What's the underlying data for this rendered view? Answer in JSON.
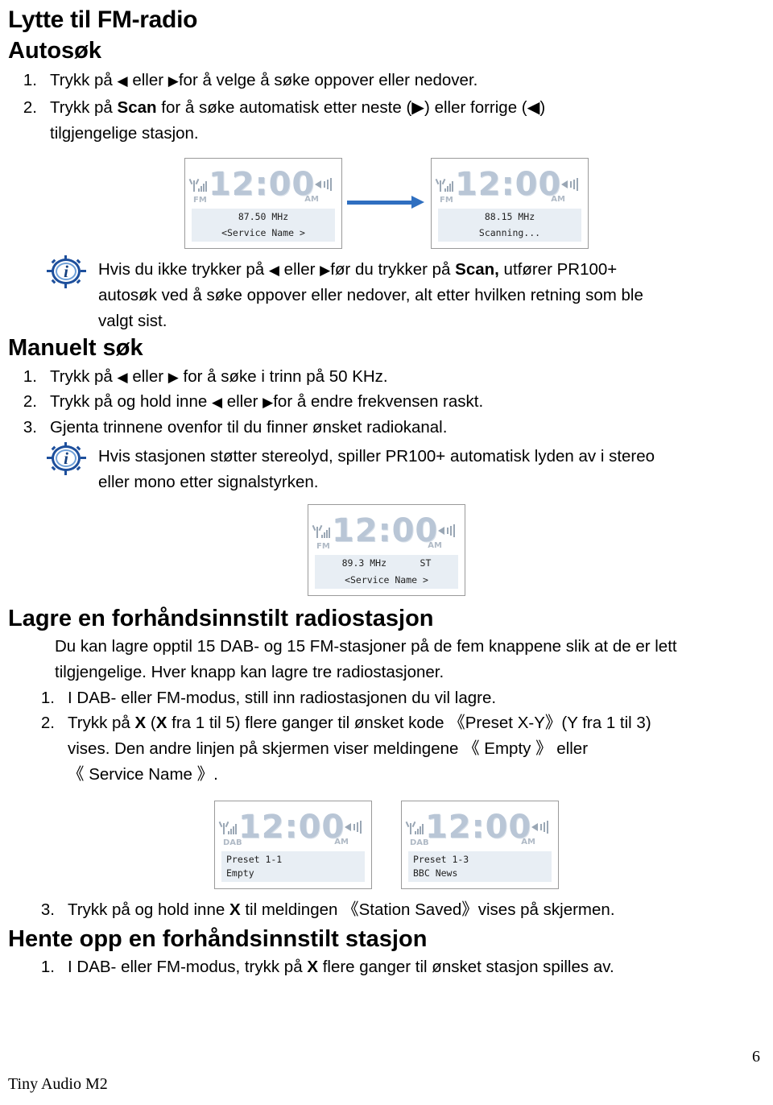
{
  "document": {
    "title": "Lytte til FM-radio",
    "footer_text": "Tiny Audio M2",
    "page_number": "6"
  },
  "sections": {
    "autosearch": {
      "heading": "Autosøk",
      "steps": [
        {
          "num": "1.",
          "text_before": "Trykk på ",
          "tri_left": "◀",
          "text_mid": " eller ",
          "tri_right": "▶",
          "text_after": "for å velge å søke oppover eller nedover."
        },
        {
          "num": "2.",
          "text": "Trykk på Scan for å søke automatisk etter neste (▶) eller forrige (◀) tilgjengelige stasjon.",
          "bold_word": "Scan"
        }
      ],
      "step2_line1_pre": "Trykk på ",
      "step2_scan": "Scan",
      "step2_line1_post": " for å søke automatisk etter neste (▶) eller forrige (◀)",
      "step2_line2": "tilgjengelige stasjon.",
      "note": {
        "icon": "info-icon",
        "line1_pre": "Hvis du ikke trykker på ",
        "tri_left": "◀",
        "line1_mid": " eller ",
        "tri_right": "▶",
        "line1_post": "før du trykker på ",
        "scan_bold": "Scan,",
        "line1_end": " utfører PR100+",
        "line2": "autosøk ved å søke oppover eller nedover, alt etter hvilken retning som ble",
        "line3": "valgt sist."
      },
      "displays": [
        {
          "clock": "12:00",
          "am": "AM",
          "mode": "FM",
          "freq_line": "87.50 MHz",
          "info_line": "<Service Name >"
        },
        {
          "clock": "12:00",
          "am": "AM",
          "mode": "FM",
          "freq_line": "88.15 MHz",
          "info_line": "Scanning..."
        }
      ]
    },
    "manual": {
      "heading": "Manuelt søk",
      "steps": [
        {
          "num": "1.",
          "pre": "Trykk på ",
          "tri_left": "◀",
          "mid": " eller ",
          "tri_right": "▶",
          "post": " for å søke i trinn på 50 KHz."
        },
        {
          "num": "2.",
          "pre": "Trykk på og hold inne ",
          "tri_left": "◀",
          "mid": " eller ",
          "tri_right": "▶",
          "post": "for å endre frekvensen raskt."
        },
        {
          "num": "3.",
          "pre": "Gjenta trinnene ovenfor til du finner ønsket radiokanal.",
          "tri_left": "",
          "mid": "",
          "tri_right": "",
          "post": ""
        }
      ],
      "note": {
        "line1": "Hvis stasjonen støtter stereolyd, spiller PR100+ automatisk lyden av i stereo",
        "line2": "eller mono etter signalstyrken."
      },
      "display": {
        "clock": "12:00",
        "am": "AM",
        "mode": "FM",
        "freq_line": "89.3 MHz      ST",
        "info_line": "<Service Name >"
      }
    },
    "preset_store": {
      "heading": "Lagre en forhåndsinnstilt radiostasjon",
      "intro_line1": "Du kan lagre opptil 15 DAB- og 15 FM-stasjoner på de fem knappene slik at de er lett",
      "intro_line2": "tilgjengelige. Hver knapp kan lagre tre radiostasjoner.",
      "steps": [
        {
          "num": "1.",
          "text": "I DAB- eller FM-modus, still inn radiostasjonen du vil lagre."
        },
        {
          "num": "2.",
          "line1_pre": "Trykk på ",
          "x1": "X",
          "line1_mid": " (",
          "x2": "X",
          "line1_mid2": " fra 1 til 5) flere ganger til ønsket kode 《Preset X-Y》(Y fra 1 til 3)",
          "line2": "vises. Den andre linjen på skjermen viser meldingene 《 Empty 》 eller",
          "line3": "《 Service Name 》."
        }
      ],
      "displays": [
        {
          "clock": "12:00",
          "am": "AM",
          "mode": "DAB",
          "line1": "Preset 1-1",
          "line2": "Empty"
        },
        {
          "clock": "12:00",
          "am": "AM",
          "mode": "DAB",
          "line1": "Preset 1-3",
          "line2": "BBC News"
        }
      ],
      "step3": {
        "num": "3.",
        "pre": "Trykk på og hold inne ",
        "x": "X",
        "post": " til meldingen 《Station Saved》vises på skjermen."
      }
    },
    "preset_recall": {
      "heading": "Hente opp en forhåndsinnstilt stasjon",
      "steps": [
        {
          "num": "1.",
          "pre": "I DAB- eller FM-modus, trykk på ",
          "x": "X",
          "post": " flere ganger til ønsket stasjon spilles av."
        }
      ]
    }
  },
  "colors": {
    "arrow": "#2f6fc0",
    "info_icon_border": "#1d4f9c",
    "lcd_digit": "#b9c6d6",
    "lcd_shade": "#e8eef4"
  }
}
